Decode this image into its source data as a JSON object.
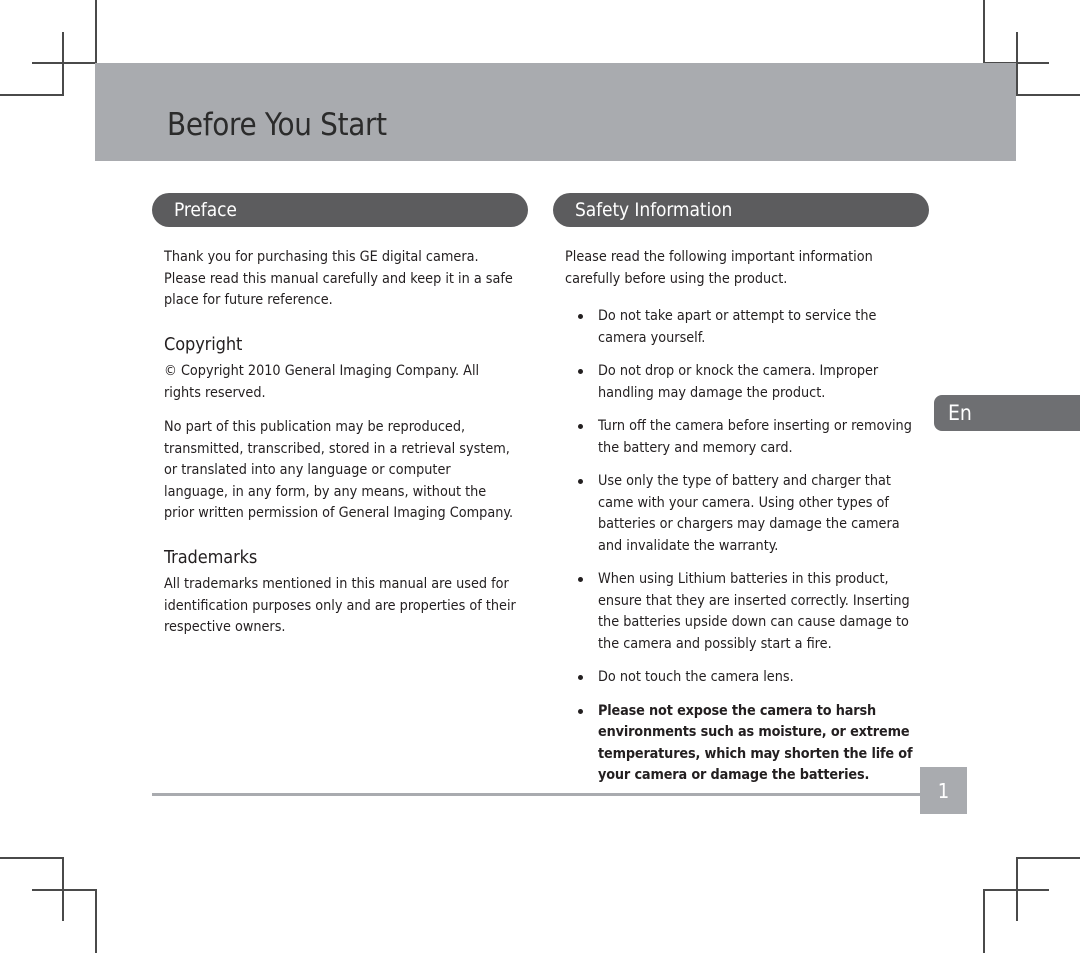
{
  "page": {
    "chapter_title": "Before You Start",
    "language_tab": "En",
    "page_number": "1",
    "colors": {
      "masthead_gray": "#a9abaf",
      "pill_gray": "#5c5c5e",
      "tab_gray": "#6e6f72",
      "text": "#231f20"
    }
  },
  "left_column": {
    "section_title": "Preface",
    "intro": "Thank you for purchasing this GE digital camera. Please read this manual carefully and keep it in a safe place for future reference.",
    "copyright": {
      "heading": "Copyright",
      "paragraphs": [
        "© Copyright 2010 General Imaging Company. All rights reserved.",
        "No part of this publication may be reproduced, transmitted, transcribed, stored in a retrieval system, or translated into any language or computer language, in any form, by any means, without the prior written permission of General Imaging Company."
      ]
    },
    "trademarks": {
      "heading": "Trademarks",
      "paragraphs": [
        "All trademarks mentioned in this manual are used for identification purposes only and are properties of their respective owners."
      ]
    }
  },
  "right_column": {
    "section_title": "Safety Information",
    "intro": "Please read the following important information carefully before using the product.",
    "bullets": [
      {
        "text": "Do not take apart or attempt to service the camera yourself.",
        "emphasis": false
      },
      {
        "text": "Do not drop or knock the camera. Improper handling may damage the product.",
        "emphasis": false
      },
      {
        "text": "Turn off the camera before inserting or removing the battery and memory card.",
        "emphasis": false
      },
      {
        "text": "Use only the type of battery and charger that came with your camera. Using other types of batteries or chargers may damage the camera and invalidate the warranty.",
        "emphasis": false
      },
      {
        "text": "When using Lithium batteries in this product, ensure that they are inserted correctly. Inserting the batteries upside down can cause damage to the camera and possibly start a fire.",
        "emphasis": false
      },
      {
        "text": "Do not touch the camera lens.",
        "emphasis": false
      },
      {
        "text": "Please not expose the camera to harsh environments such as moisture, or extreme temperatures, which may shorten the life of your camera or damage the batteries.",
        "emphasis": true
      }
    ]
  }
}
